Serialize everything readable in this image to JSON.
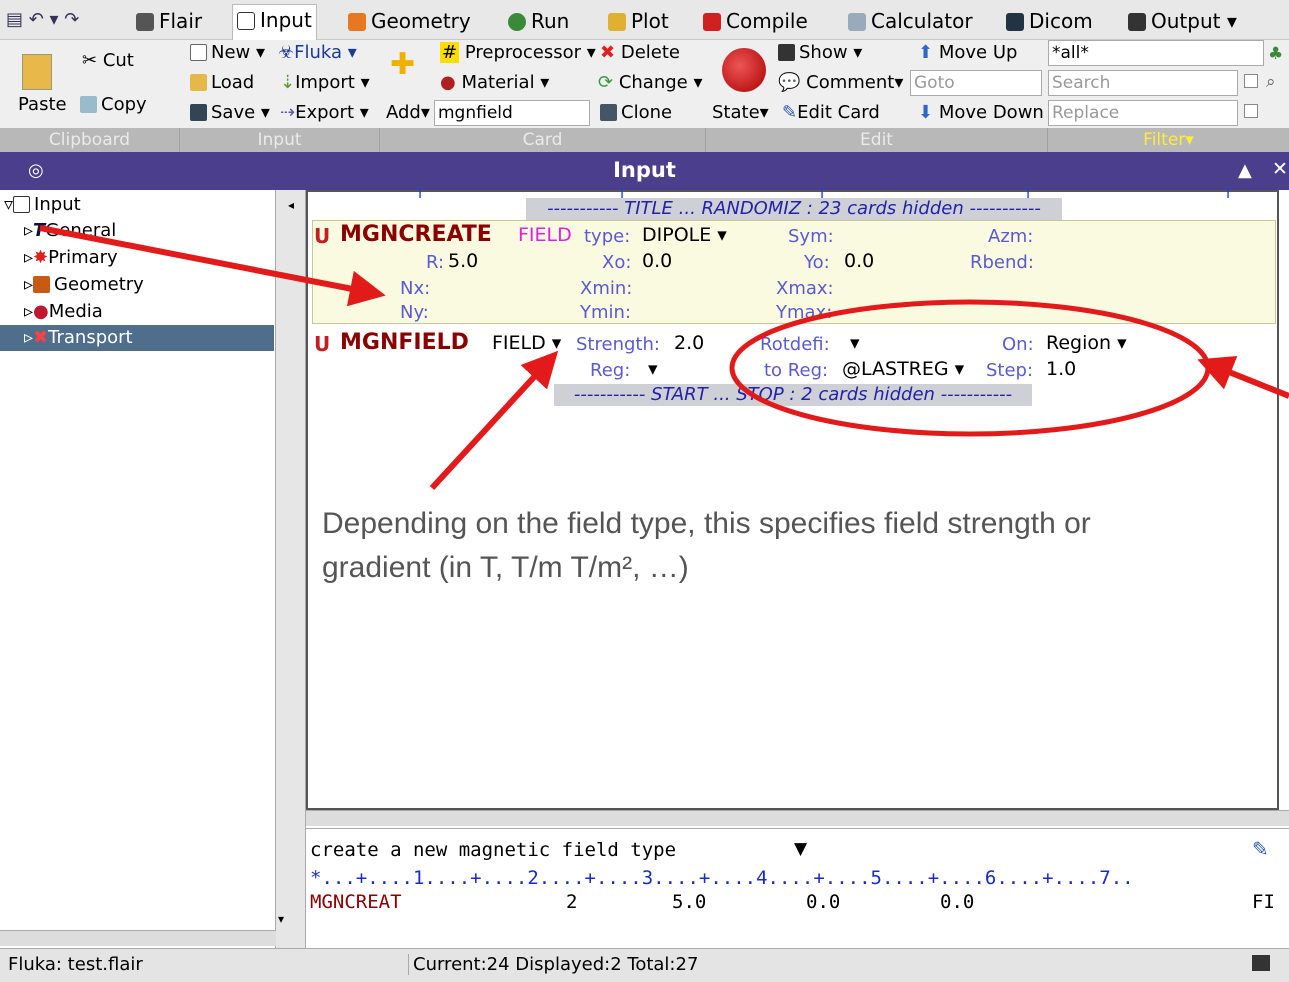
{
  "tabs": [
    "Flair",
    "Input",
    "Geometry",
    "Run",
    "Plot",
    "Compile",
    "Calculator",
    "Dicom",
    "Output"
  ],
  "ribbon": {
    "cut": "Cut",
    "copy": "Copy",
    "paste": "Paste",
    "new": "New",
    "load": "Load",
    "save": "Save",
    "fluka": "Fluka",
    "import": "Import",
    "export": "Export",
    "add": "Add",
    "card_value": "mgnfield",
    "preprocessor": "Preprocessor",
    "material": "Material",
    "clone": "Clone",
    "delete": "Delete",
    "change": "Change",
    "show": "Show",
    "comment": "Comment",
    "state": "State",
    "edit_card": "Edit Card",
    "goto_placeholder": "Goto",
    "move_up": "Move Up",
    "move_down": "Move Down",
    "filter_value": "*all*",
    "search_placeholder": "Search",
    "replace_placeholder": "Replace"
  },
  "groups": [
    "Clipboard",
    "Input",
    "Card",
    "Edit",
    "Filter"
  ],
  "panel_title": "Input",
  "tree": [
    "Input",
    "General",
    "Primary",
    "Geometry",
    "Media",
    "Transport"
  ],
  "hidden1": "----------- TITLE ... RANDOMIZ : 23 cards hidden -----------",
  "card1": {
    "name": "MGNCREATE",
    "tag": "FIELD",
    "type_lbl": "type:",
    "type_val": "DIPOLE ▾",
    "sym": "Sym:",
    "azm": "Azm:",
    "r_lbl": "R:",
    "r_val": "5.0",
    "xo_lbl": "Xo:",
    "xo_val": "0.0",
    "yo_lbl": "Yo:",
    "yo_val": "0.0",
    "rbend": "Rbend:",
    "nx": "Nx:",
    "xmin": "Xmin:",
    "xmax": "Xmax:",
    "ny": "Ny:",
    "ymin": "Ymin:",
    "ymax": "Ymax:"
  },
  "card2": {
    "name": "MGNFIELD",
    "tag": "FIELD ▾",
    "strength_lbl": "Strength:",
    "strength_val": "2.0",
    "rotdefi_lbl": "Rotdefi:",
    "rotdefi_val": "▾",
    "on_lbl": "On:",
    "on_val": "Region ▾",
    "reg_lbl": "Reg:",
    "reg_val": "▾",
    "toreg_lbl": "to Reg:",
    "toreg_val": "@LASTREG ▾",
    "step_lbl": "Step:",
    "step_val": "1.0"
  },
  "hidden2": "----------- START ... STOP : 2 cards hidden -----------",
  "annotation": "Depending on the field type, this specifies field strength or gradient (in T, T/m T/m², …)",
  "bottom": {
    "desc": "create a new magnetic field type",
    "ruler": "*...+....1....+....2....+....3....+....4....+....5....+....6....+....7..",
    "line_name": "MGNCREAT",
    "line_v1": "2",
    "line_v2": "5.0",
    "line_v3": "0.0",
    "line_v4": "0.0",
    "line_end": "FI"
  },
  "status": {
    "left": "Fluka: test.flair",
    "mid": "Current:24  Displayed:2 Total:27"
  }
}
